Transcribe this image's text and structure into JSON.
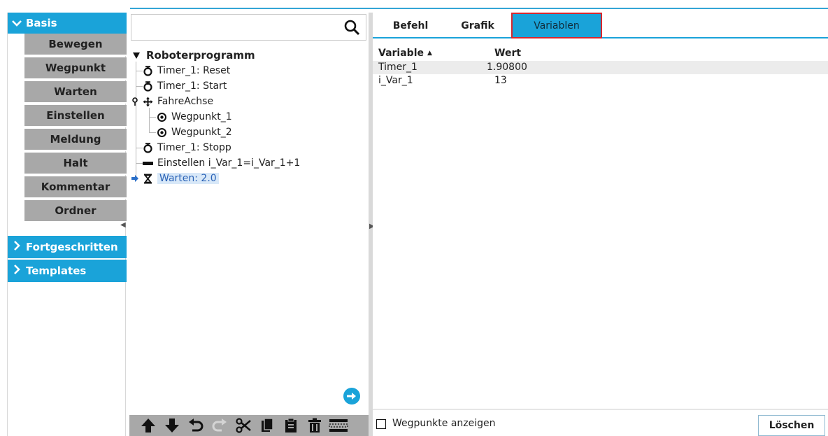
{
  "sidebar": {
    "categories": [
      {
        "label": "Basis",
        "expanded": true
      },
      {
        "label": "Fortgeschritten",
        "expanded": false
      },
      {
        "label": "Templates",
        "expanded": false
      }
    ],
    "basis_items": [
      "Bewegen",
      "Wegpunkt",
      "Warten",
      "Einstellen",
      "Meldung",
      "Halt",
      "Kommentar",
      "Ordner"
    ]
  },
  "search": {
    "value": "",
    "placeholder": ""
  },
  "program_tree": {
    "root": "Roboterprogramm",
    "nodes": [
      {
        "label": "Timer_1: Reset",
        "icon": "timer-icon",
        "depth": 1
      },
      {
        "label": "Timer_1: Start",
        "icon": "timer-icon",
        "depth": 1
      },
      {
        "label": "FahreAchse",
        "icon": "move-icon",
        "depth": 1
      },
      {
        "label": "Wegpunkt_1",
        "icon": "waypoint-icon",
        "depth": 2
      },
      {
        "label": "Wegpunkt_2",
        "icon": "waypoint-icon",
        "depth": 2
      },
      {
        "label": "Timer_1: Stopp",
        "icon": "timer-icon",
        "depth": 1
      },
      {
        "label": "Einstellen i_Var_1=i_Var_1+1",
        "icon": "set-icon",
        "depth": 1
      },
      {
        "label": "Warten: 2.0",
        "icon": "hourglass-icon",
        "depth": 1,
        "selected": true
      }
    ]
  },
  "tabs": [
    "Befehl",
    "Grafik",
    "Variablen"
  ],
  "active_tab": "Variablen",
  "variables": {
    "col_variable": "Variable",
    "col_value": "Wert",
    "rows": [
      {
        "name": "Timer_1",
        "value": "1.90800"
      },
      {
        "name": "i_Var_1",
        "value": "13"
      }
    ]
  },
  "bottom": {
    "show_waypoints_label": "Wegpunkte anzeigen",
    "show_waypoints_checked": false,
    "clear_label": "Löschen"
  },
  "colors": {
    "accent": "#1aa3d9",
    "submenu": "#a8a8a8",
    "active_tab_border": "#d9262c",
    "selection": "#d8e8f8"
  }
}
